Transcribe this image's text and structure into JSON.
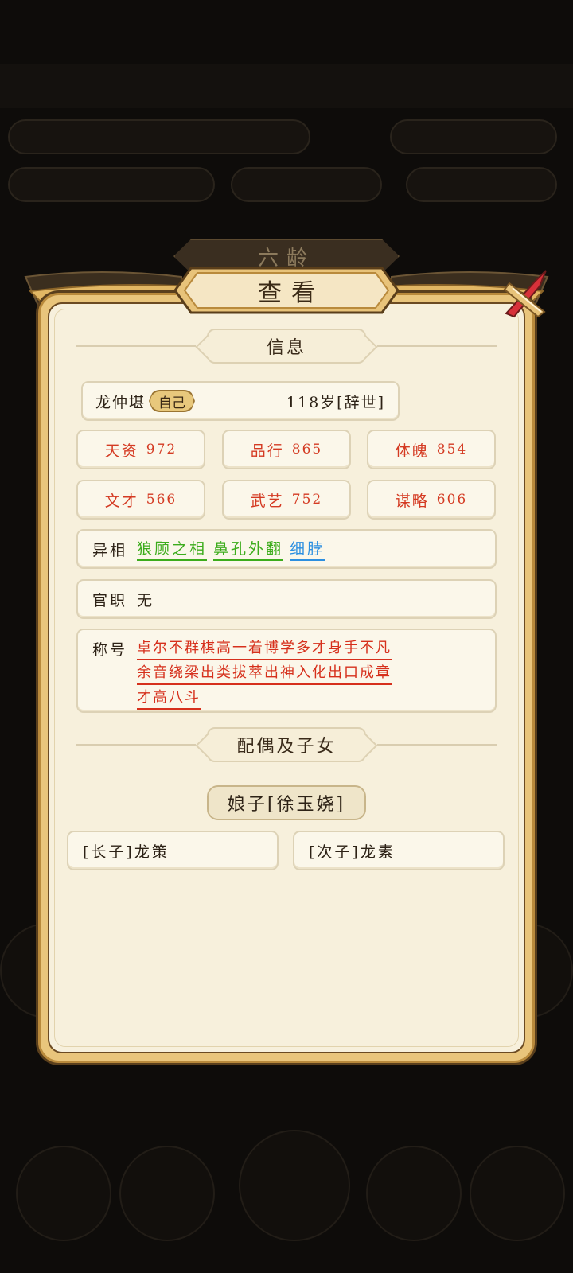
{
  "dialog": {
    "background_title": "六龄",
    "title": "查看",
    "close_icon": "close-x-icon"
  },
  "info_section": {
    "header": "信息",
    "name": "龙仲堪",
    "self_badge": "自己",
    "age_status": "118岁[辞世]",
    "stats": [
      {
        "label": "天资",
        "value": "972"
      },
      {
        "label": "品行",
        "value": "865"
      },
      {
        "label": "体魄",
        "value": "854"
      },
      {
        "label": "文才",
        "value": "566"
      },
      {
        "label": "武艺",
        "value": "752"
      },
      {
        "label": "谋略",
        "value": "606"
      }
    ],
    "appearance": {
      "label": "异相",
      "traits": [
        {
          "text": "狼顾之相",
          "color": "#3cac1c"
        },
        {
          "text": "鼻孔外翻",
          "color": "#3cac1c"
        },
        {
          "text": "细脖",
          "color": "#2c8fe0"
        }
      ]
    },
    "office": {
      "label": "官职",
      "value": "无"
    },
    "titles": {
      "label": "称号",
      "lines": [
        "卓尔不群棋高一着博学多才身手不凡",
        "余音绕梁出类拔萃出神入化出口成章",
        "才高八斗"
      ]
    }
  },
  "family_section": {
    "header": "配偶及子女",
    "spouse": "娘子[徐玉娆]",
    "children": [
      {
        "label": "[长子]龙策"
      },
      {
        "label": "[次子]龙素"
      }
    ]
  },
  "colors": {
    "stat_red": "#d43a22",
    "title_red": "#d6301c",
    "frame_gold": "#e9c57c",
    "panel_cream": "#f7f0dc"
  }
}
